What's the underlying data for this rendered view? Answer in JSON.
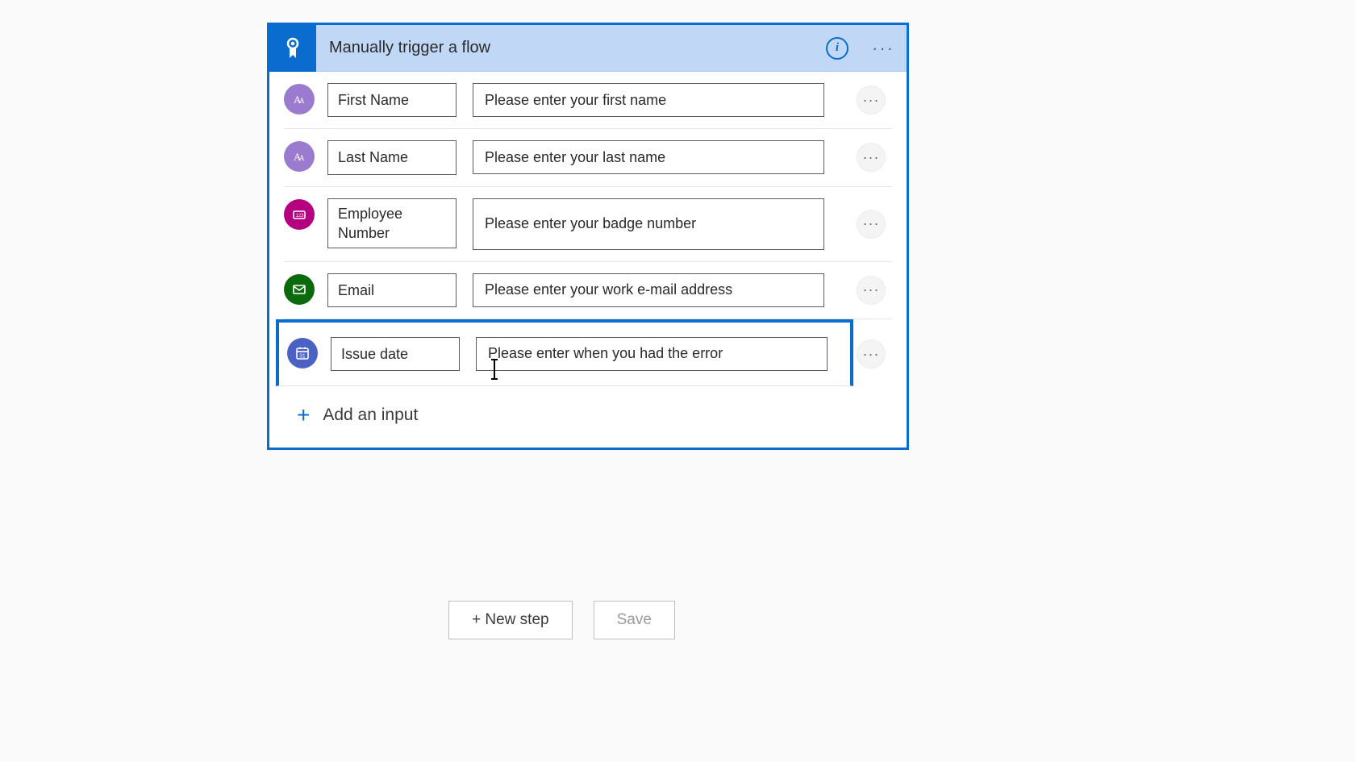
{
  "trigger": {
    "title": "Manually trigger a flow",
    "addInputLabel": "Add an input"
  },
  "inputs": [
    {
      "name": "First Name",
      "description": "Please enter your first name",
      "type": "text"
    },
    {
      "name": "Last Name",
      "description": "Please enter your last name",
      "type": "text"
    },
    {
      "name": "Employee Number",
      "description": "Please enter your badge number",
      "type": "number"
    },
    {
      "name": "Email",
      "description": "Please enter your work e-mail address",
      "type": "email"
    },
    {
      "name": "Issue date",
      "description": "Please enter when you had the error",
      "type": "date"
    }
  ],
  "footer": {
    "newStep": "+ New step",
    "save": "Save"
  }
}
